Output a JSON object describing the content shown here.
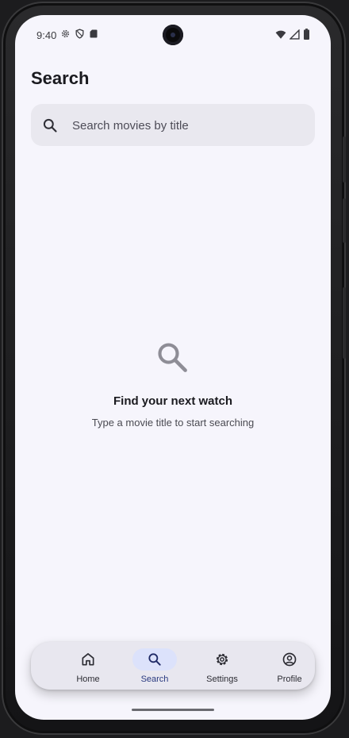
{
  "status_bar": {
    "time": "9:40",
    "left_icons": [
      "settings-gear-icon",
      "shield-icon",
      "sd-card-icon"
    ],
    "right_icons": [
      "wifi-icon",
      "signal-icon",
      "battery-icon"
    ]
  },
  "page": {
    "title": "Search"
  },
  "search": {
    "placeholder": "Search movies by title",
    "value": ""
  },
  "empty_state": {
    "icon": "magnifier-icon",
    "title": "Find your next watch",
    "subtitle": "Type a movie title to start searching"
  },
  "bottom_nav": {
    "active": "Search",
    "items": [
      {
        "label": "Home",
        "icon": "home-icon"
      },
      {
        "label": "Search",
        "icon": "search-icon"
      },
      {
        "label": "Settings",
        "icon": "gear-icon"
      },
      {
        "label": "Profile",
        "icon": "profile-icon"
      }
    ]
  },
  "colors": {
    "screen_bg": "#f6f5fc",
    "search_bg": "#e9e8ef",
    "nav_bg": "#e8e7ef",
    "active_pill": "#dce2fb",
    "text_primary": "#1a1a1f",
    "text_secondary": "#4a4a52"
  }
}
